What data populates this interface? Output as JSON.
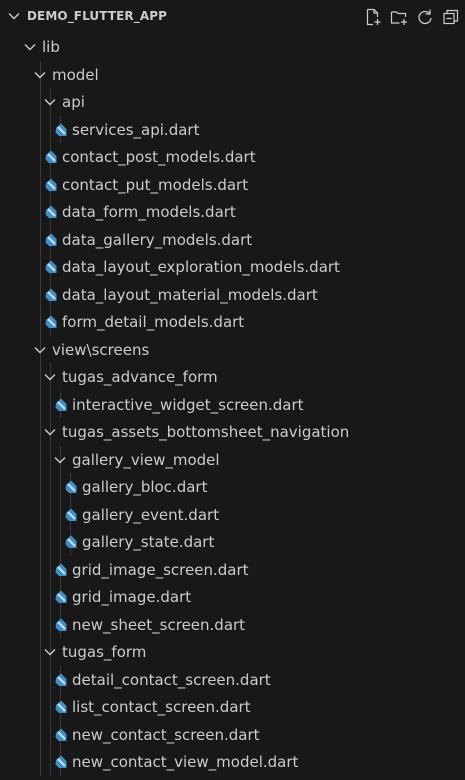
{
  "explorer": {
    "title": "DEMO_FLUTTER_APP",
    "actions": [
      "new-file-icon",
      "new-folder-icon",
      "refresh-icon",
      "collapse-all-icon"
    ]
  },
  "tree": [
    {
      "label": "lib",
      "type": "folder",
      "depth": 1
    },
    {
      "label": "model",
      "type": "folder",
      "depth": 2
    },
    {
      "label": "api",
      "type": "folder",
      "depth": 3
    },
    {
      "label": "services_api.dart",
      "type": "file",
      "depth": 4
    },
    {
      "label": "contact_post_models.dart",
      "type": "file",
      "depth": 3
    },
    {
      "label": "contact_put_models.dart",
      "type": "file",
      "depth": 3
    },
    {
      "label": "data_form_models.dart",
      "type": "file",
      "depth": 3
    },
    {
      "label": "data_gallery_models.dart",
      "type": "file",
      "depth": 3
    },
    {
      "label": "data_layout_exploration_models.dart",
      "type": "file",
      "depth": 3
    },
    {
      "label": "data_layout_material_models.dart",
      "type": "file",
      "depth": 3
    },
    {
      "label": "form_detail_models.dart",
      "type": "file",
      "depth": 3
    },
    {
      "label": "view\\screens",
      "type": "folder",
      "depth": 2
    },
    {
      "label": "tugas_advance_form",
      "type": "folder",
      "depth": 3
    },
    {
      "label": "interactive_widget_screen.dart",
      "type": "file",
      "depth": 4
    },
    {
      "label": "tugas_assets_bottomsheet_navigation",
      "type": "folder",
      "depth": 3
    },
    {
      "label": "gallery_view_model",
      "type": "folder",
      "depth": 4
    },
    {
      "label": "gallery_bloc.dart",
      "type": "file",
      "depth": 5
    },
    {
      "label": "gallery_event.dart",
      "type": "file",
      "depth": 5
    },
    {
      "label": "gallery_state.dart",
      "type": "file",
      "depth": 5
    },
    {
      "label": "grid_image_screen.dart",
      "type": "file",
      "depth": 4
    },
    {
      "label": "grid_image.dart",
      "type": "file",
      "depth": 4
    },
    {
      "label": "new_sheet_screen.dart",
      "type": "file",
      "depth": 4
    },
    {
      "label": "tugas_form",
      "type": "folder",
      "depth": 3
    },
    {
      "label": "detail_contact_screen.dart",
      "type": "file",
      "depth": 4
    },
    {
      "label": "list_contact_screen.dart",
      "type": "file",
      "depth": 4
    },
    {
      "label": "new_contact_screen.dart",
      "type": "file",
      "depth": 4
    },
    {
      "label": "new_contact_view_model.dart",
      "type": "file",
      "depth": 4
    }
  ],
  "colors": {
    "background": "#181818",
    "text": "#cccccc",
    "icon": "#cccccc",
    "dart_icon": "#3f8fc9",
    "guide": "#3a3a3a"
  }
}
